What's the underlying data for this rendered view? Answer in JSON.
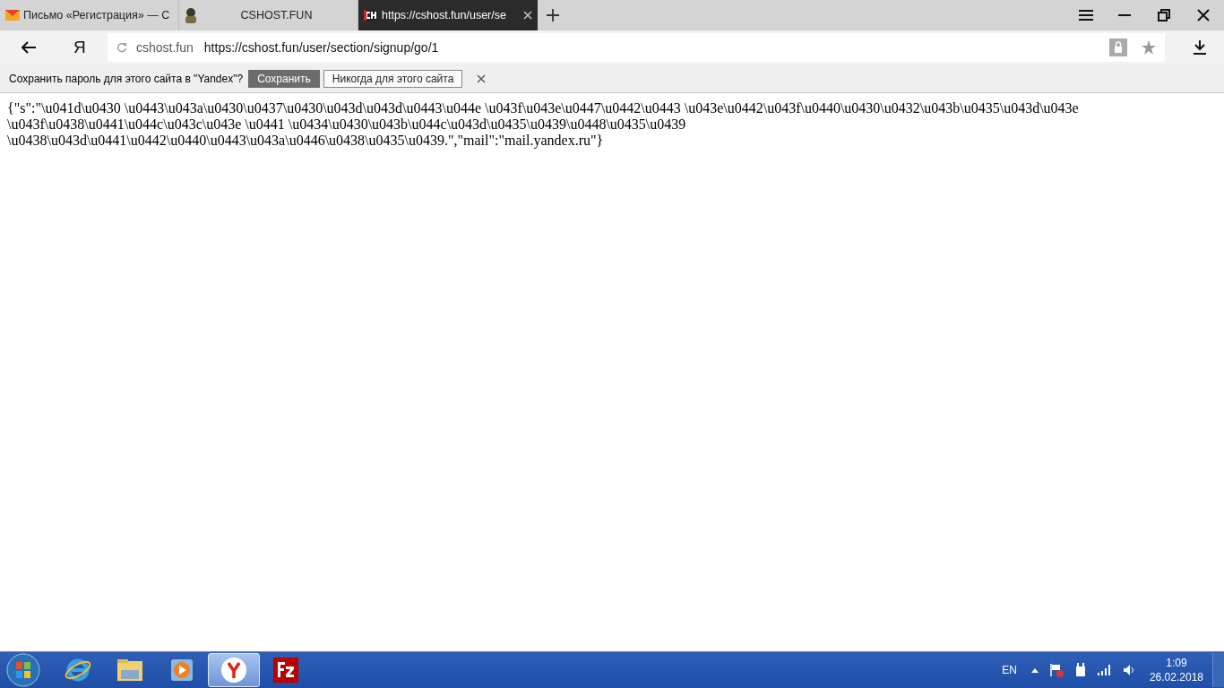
{
  "tabs": [
    {
      "kind": "mail",
      "title": "Письмо «Регистрация» — С",
      "selected": false
    },
    {
      "kind": "avatar",
      "title": "CSHOST.FUN",
      "selected": false
    },
    {
      "kind": "site",
      "title": "https://cshost.fun/user/se",
      "selected": true
    }
  ],
  "address_bar": {
    "domain": "cshost.fun",
    "url": "https://cshost.fun/user/section/signup/go/1"
  },
  "logo": "Я",
  "password_bar": {
    "question": "Сохранить пароль для этого сайта в \"Yandex\"?",
    "save_button": "Сохранить",
    "never_button": "Никогда для этого сайта"
  },
  "page_text": "{\"s\":\"\\u041d\\u0430 \\u0443\\u043a\\u0430\\u0437\\u0430\\u043d\\u043d\\u0443\\u044e \\u043f\\u043e\\u0447\\u0442\\u0443 \\u043e\\u0442\\u043f\\u0440\\u0430\\u0432\\u043b\\u0435\\u043d\\u043e \\u043f\\u0438\\u0441\\u044c\\u043c\\u043e \\u0441 \\u0434\\u0430\\u043b\\u044c\\u043d\\u0435\\u0439\\u0448\\u0435\\u0439 \\u0438\\u043d\\u0441\\u0442\\u0440\\u0443\\u043a\\u0446\\u0438\\u0435\\u0439.\",\"mail\":\"mail.yandex.ru\"}",
  "taskbar": {
    "apps": [
      {
        "kind": "ie",
        "selected": false
      },
      {
        "kind": "explorer",
        "selected": false
      },
      {
        "kind": "media",
        "selected": false
      },
      {
        "kind": "yandex",
        "selected": true
      },
      {
        "kind": "filezilla",
        "selected": false
      }
    ],
    "language": "EN",
    "time": "1:09",
    "date": "26.02.2018"
  }
}
